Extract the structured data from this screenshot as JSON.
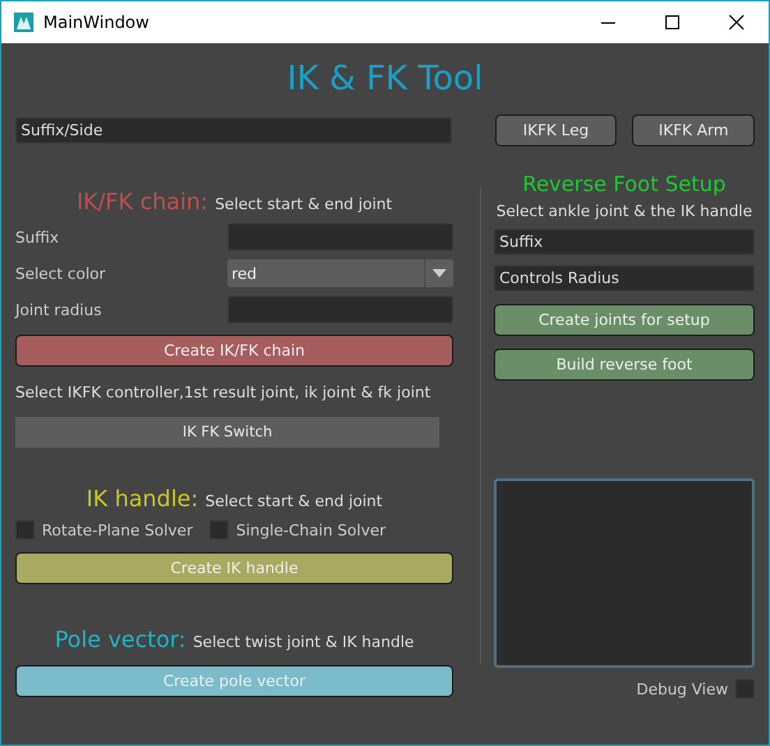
{
  "window": {
    "title": "MainWindow"
  },
  "title": "IK & FK Tool",
  "top_bar": {
    "field": {
      "placeholder": "Suffix/Side"
    },
    "buttons": [
      "IKFK Leg",
      "IKFK Arm"
    ]
  },
  "chain": {
    "heading": "IK/FK chain:",
    "color": "#c0504d",
    "hint": "Select start & end joint",
    "rows": [
      {
        "label": "Suffix",
        "kind": "field"
      },
      {
        "label": "Select color",
        "kind": "dropdown",
        "value": "red"
      },
      {
        "label": "Joint radius",
        "kind": "field"
      }
    ],
    "button": {
      "label": "Create IK/FK chain",
      "color": "#a55d5d"
    },
    "note": "Select IKFK controller,1st result joint, ik joint & fk joint",
    "switch_button": "IK FK Switch"
  },
  "ik_handle": {
    "heading": "IK handle:",
    "color": "#c8c81e",
    "hint": "Select start & end joint",
    "options": [
      {
        "label": "Rotate-Plane Solver",
        "checked": false
      },
      {
        "label": "Single-Chain Solver",
        "checked": false
      }
    ],
    "button": {
      "label": "Create IK handle",
      "color": "#a9a962"
    }
  },
  "pole_vector": {
    "heading": "Pole vector:",
    "color": "#1eb4c8",
    "hint": "Select twist joint & IK handle",
    "button": {
      "label": "Create pole vector",
      "color": "#7bbccb"
    }
  },
  "reverse_foot": {
    "heading": "Reverse Foot Setup",
    "color": "#1ec832",
    "hint": "Select ankle joint & the IK handle",
    "fields": [
      {
        "placeholder": "Suffix"
      },
      {
        "placeholder": "Controls Radius"
      }
    ],
    "buttons": [
      {
        "label": "Create joints for setup",
        "color": "#6a8e67"
      },
      {
        "label": "Build reverse foot",
        "color": "#6a8e67"
      }
    ],
    "debug_view": {
      "label": "Debug View",
      "checked": false
    }
  }
}
